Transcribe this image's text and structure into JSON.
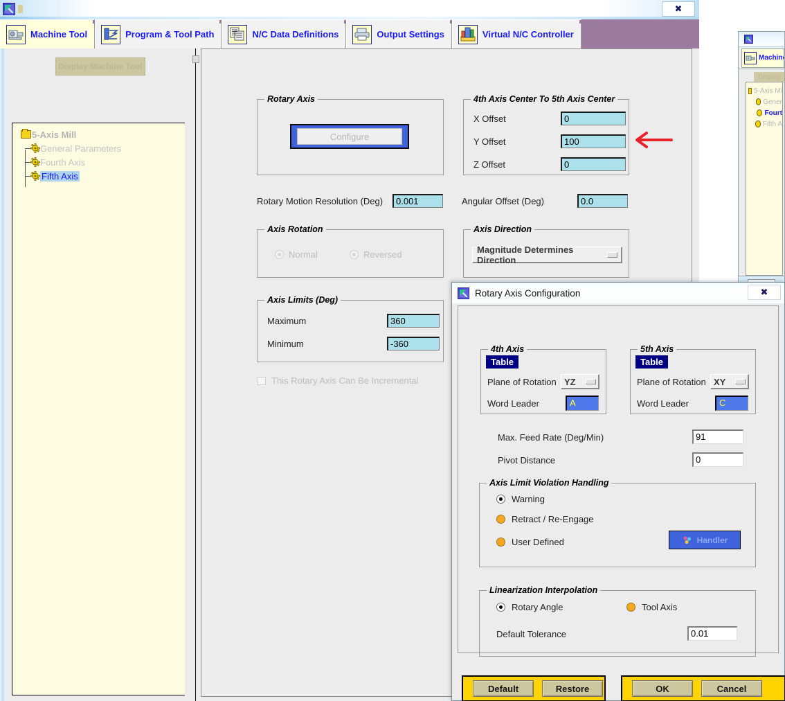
{
  "window": {
    "title": "",
    "close_label": "✖",
    "sysicon": "app-icon"
  },
  "tabs": [
    {
      "label": "Machine Tool",
      "icon": "machine-tool-icon",
      "selected": true
    },
    {
      "label": "Program & Tool Path",
      "icon": "program-tool-path-icon",
      "selected": false
    },
    {
      "label": "N/C Data Definitions",
      "icon": "nc-data-definitions-icon",
      "selected": false
    },
    {
      "label": "Output Settings",
      "icon": "printer-icon",
      "selected": false
    },
    {
      "label": "Virtual N/C Controller",
      "icon": "virtual-nc-controller-icon",
      "selected": false
    }
  ],
  "left_pane": {
    "display_button": "Display Machine Tool",
    "tree": [
      {
        "label": "5-Axis Mill",
        "level": 0,
        "icon": "folder-icon",
        "selected": false
      },
      {
        "label": "General Parameters",
        "level": 1,
        "icon": "gear-icon",
        "selected": false
      },
      {
        "label": "Fourth Axis",
        "level": 1,
        "icon": "gear-icon",
        "selected": false
      },
      {
        "label": "Fifth Axis",
        "level": 1,
        "icon": "gear-icon",
        "selected": true
      }
    ]
  },
  "main": {
    "rotary_axis": {
      "title": "Rotary Axis",
      "configure_label": "Configure"
    },
    "center_offsets": {
      "title": "4th Axis Center To 5th Axis Center",
      "rows": [
        {
          "label": "X Offset",
          "value": "0"
        },
        {
          "label": "Y Offset",
          "value": "100"
        },
        {
          "label": "Z Offset",
          "value": "0"
        }
      ]
    },
    "resolution": {
      "label": "Rotary Motion Resolution (Deg)",
      "value": "0.001"
    },
    "angular_offset": {
      "label": "Angular Offset  (Deg)",
      "value": "0.0"
    },
    "axis_rotation": {
      "title": "Axis Rotation",
      "options": [
        {
          "label": "Normal",
          "selected": true
        },
        {
          "label": "Reversed",
          "selected": false
        }
      ]
    },
    "axis_direction": {
      "title": "Axis Direction",
      "value": "Magnitude Determines Direction"
    },
    "axis_limits": {
      "title": "Axis Limits (Deg)",
      "rows": [
        {
          "label": "Maximum",
          "value": "360"
        },
        {
          "label": "Minimum",
          "value": "-360"
        }
      ]
    },
    "incremental_checkbox": {
      "label": "This Rotary Axis Can Be Incremental",
      "checked": false
    }
  },
  "dialog": {
    "title": "Rotary Axis Configuration",
    "close_label": "✖",
    "fourth_axis": {
      "title": "4th Axis",
      "tag": "Table",
      "plane_label": "Plane of Rotation",
      "plane_value": "YZ",
      "word_leader_label": "Word Leader",
      "word_leader_value": "A"
    },
    "fifth_axis": {
      "title": "5th Axis",
      "tag": "Table",
      "plane_label": "Plane of Rotation",
      "plane_value": "XY",
      "word_leader_label": "Word Leader",
      "word_leader_value": "C"
    },
    "feed_rate": {
      "label": "Max. Feed Rate (Deg/Min)",
      "value": "91"
    },
    "pivot_distance": {
      "label": "Pivot Distance",
      "value": "0"
    },
    "violation_handling": {
      "title": "Axis Limit Violation Handling",
      "options": [
        {
          "label": "Warning",
          "selected": true
        },
        {
          "label": "Retract / Re-Engage",
          "selected": false
        },
        {
          "label": "User Defined",
          "selected": false
        }
      ],
      "handler_button": "Handler"
    },
    "linearization": {
      "title": "Linearization Interpolation",
      "options": [
        {
          "label": "Rotary Angle",
          "selected": true
        },
        {
          "label": "Tool Axis",
          "selected": false
        }
      ],
      "tolerance_label": "Default Tolerance",
      "tolerance_value": "0.01"
    },
    "buttons": {
      "default": "Default",
      "restore": "Restore",
      "ok": "OK",
      "cancel": "Cancel"
    }
  },
  "background_window": {
    "tab_label": "Machine To",
    "display_button": "Display",
    "tree": [
      {
        "label": "5-Axis Mi",
        "selected": false
      },
      {
        "label": "Gener",
        "selected": false
      },
      {
        "label": "Fourt",
        "selected": true
      },
      {
        "label": "Fifth A",
        "selected": false
      }
    ],
    "close_label": "✖"
  },
  "annotation": {
    "arrow": "left-arrow-annotation",
    "color": "#e8222a"
  },
  "colors": {
    "field_blue": "#ace0ea",
    "button_tan": "#cdc79f",
    "band_yellow": "#ffd400",
    "tab_text": "#1a1aff",
    "tag_navy": "#000080",
    "word_leader_blue": "#4e78ec",
    "word_leader_text": "#ffff33",
    "focus_blue": "#3f62dd",
    "tree_bg": "#fdfbe0"
  }
}
